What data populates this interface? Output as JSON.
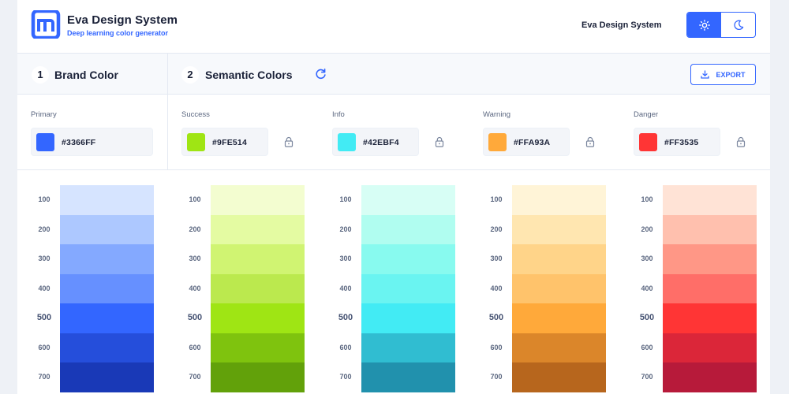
{
  "header": {
    "title": "Eva Design System",
    "subtitle": "Deep learning color generator",
    "link": "Eva Design System",
    "theme": {
      "light_icon": "sun-icon",
      "dark_icon": "moon-icon",
      "active": "light"
    }
  },
  "sections": {
    "brand": {
      "number": "1",
      "label": "Brand Color"
    },
    "semantic": {
      "number": "2",
      "label": "Semantic Colors",
      "refresh_icon": "refresh-icon"
    },
    "export_label": "EXPORT",
    "export_icon": "download-icon"
  },
  "colors": {
    "primary": {
      "label": "Primary",
      "hex": "#3366FF",
      "locked": false
    },
    "success": {
      "label": "Success",
      "hex": "#9FE514",
      "locked": true
    },
    "info": {
      "label": "Info",
      "hex": "#42EBF4",
      "locked": true
    },
    "warning": {
      "label": "Warning",
      "hex": "#FFA93A",
      "locked": true
    },
    "danger": {
      "label": "Danger",
      "hex": "#FF3535",
      "locked": true
    }
  },
  "shade_labels": [
    "100",
    "200",
    "300",
    "400",
    "500",
    "600",
    "700"
  ],
  "palettes": {
    "primary": [
      "#d6e4ff",
      "#adc8ff",
      "#84a9ff",
      "#6690ff",
      "#3366ff",
      "#254edb",
      "#1939b7"
    ],
    "success": [
      "#f3fdd0",
      "#e4fba2",
      "#d0f472",
      "#bbe94e",
      "#9fe514",
      "#7fc30e",
      "#62a10a"
    ],
    "info": [
      "#d7fef5",
      "#b0fdf0",
      "#88faef",
      "#6af4f1",
      "#42ebf4",
      "#30bdd1",
      "#2191ad"
    ],
    "warning": [
      "#fff4d7",
      "#ffe6b0",
      "#ffd489",
      "#ffc36b",
      "#ffa93a",
      "#db862a",
      "#b7661d"
    ],
    "danger": [
      "#ffe3d6",
      "#ffc0ae",
      "#ff9786",
      "#ff6e68",
      "#ff3535",
      "#db2639",
      "#b71a3a"
    ]
  }
}
